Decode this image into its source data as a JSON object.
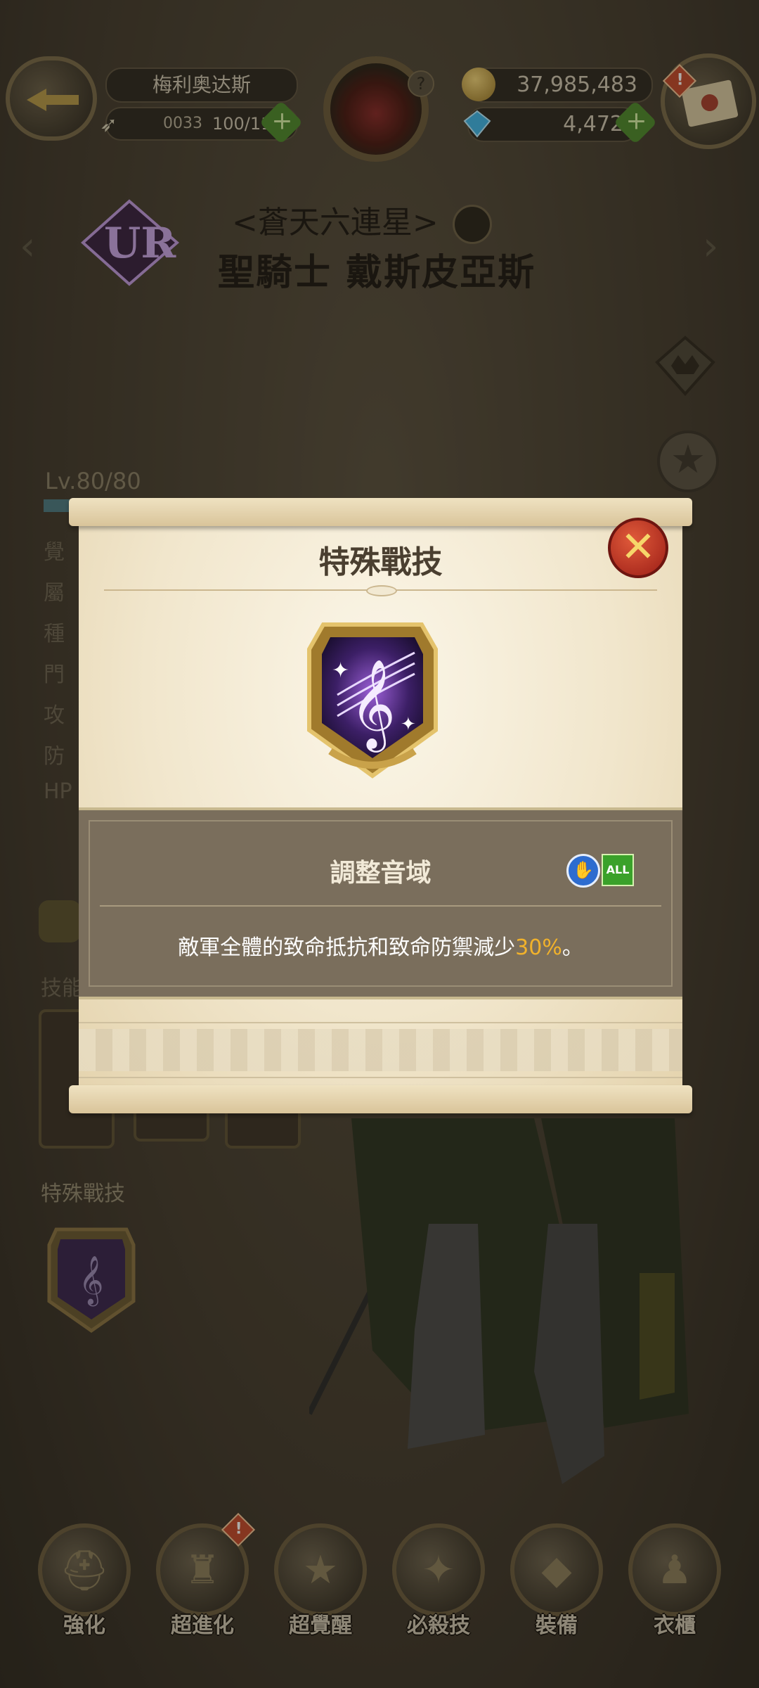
{
  "header": {
    "player_name": "梅利奥达斯",
    "stamina_timer": "0033",
    "stamina": "100/114",
    "gold": "37,985,483",
    "gems": "4,472"
  },
  "hero": {
    "subtitle": "<蒼天六連星>",
    "name": "聖騎士 戴斯皮亞斯",
    "rarity": "UR",
    "level": "Lv.80/80",
    "stat_labels": [
      "覺",
      "屬",
      "種",
      "門",
      "攻",
      "防",
      "HP"
    ],
    "skills_title": "技能",
    "special_title": "特殊戰技"
  },
  "modal": {
    "title": "特殊戰技",
    "close_symbol": "✕",
    "skill_name": "調整音域",
    "target_tag": "ALL",
    "desc_prefix": "敵軍全體的致命抵抗和致命防禦減少",
    "desc_value": "30%",
    "desc_suffix": "。"
  },
  "bottom_nav": [
    {
      "label": "強化",
      "icon": "helmet-icon"
    },
    {
      "label": "超進化",
      "icon": "evolve-icon"
    },
    {
      "label": "超覺醒",
      "icon": "awaken-star-icon"
    },
    {
      "label": "必殺技",
      "icon": "ultimate-icon"
    },
    {
      "label": "裝備",
      "icon": "equipment-icon"
    },
    {
      "label": "衣櫃",
      "icon": "wardrobe-icon"
    }
  ],
  "colors": {
    "highlight": "#f1b22b",
    "close_red": "#c0281e",
    "tag_blue": "#2d6ccf",
    "tag_green": "#3aa12a"
  }
}
